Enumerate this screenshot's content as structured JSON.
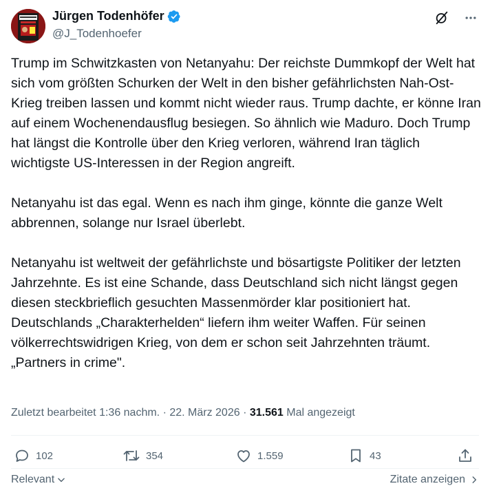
{
  "author": {
    "name": "Jürgen Todenhöfer",
    "handle": "@J_Todenhoefer"
  },
  "tweet": {
    "paragraph_1": "Trump im Schwitzkasten von Netanyahu: Der reichste Dummkopf der Welt hat sich vom größten Schurken der Welt in den bisher gefährlichsten Nah-Ost-Krieg treiben lassen und kommt nicht wieder raus. Trump dachte, er könne Iran auf einem Wochenendausflug besiegen. So ähnlich wie Maduro. Doch Trump hat längst die Kontrolle über den Krieg verloren, während Iran täglich wichtigste US-Interessen in der Region angreift.",
    "paragraph_2": "Netanyahu ist das egal. Wenn es nach ihm ginge, könnte die ganze Welt abbrennen, solange nur Israel überlebt.",
    "paragraph_3": "Netanyahu ist weltweit der gefährlichste und bösartigste Politiker der letzten Jahrzehnte. Es ist eine Schande, dass Deutschland sich nicht längst gegen diesen steckbrieflich gesuchten Massenmörder klar positioniert hat. Deutschlands „Charakterhelden“ liefern ihm weiter Waffen. Für seinen völkerrechtswidrigen Krieg, von dem er schon seit Jahrzehnten träumt. „Partners in crime\"."
  },
  "meta": {
    "edited": "Zuletzt bearbeitet 1:36 nachm.",
    "separator": " · ",
    "date": "22. März 2026",
    "views_count": "31.561",
    "views_label": "Mal angezeigt"
  },
  "actions": {
    "replies": "102",
    "reposts": "354",
    "likes": "1.559",
    "bookmarks": "43"
  },
  "footer": {
    "sort_label": "Relevant",
    "quotes_label": "Zitate anzeigen"
  },
  "colors": {
    "text": "#0f1419",
    "secondary": "#536471",
    "verified": "#1d9bf0",
    "divider": "#eff3f4"
  },
  "icons": {
    "verified": "verified-badge-icon",
    "grok": "grok-icon",
    "more": "more-icon",
    "reply": "reply-icon",
    "repost": "repost-icon",
    "like": "like-icon",
    "bookmark": "bookmark-icon",
    "share": "share-icon",
    "chevron_down": "chevron-down-icon",
    "chevron_right": "chevron-right-icon"
  }
}
